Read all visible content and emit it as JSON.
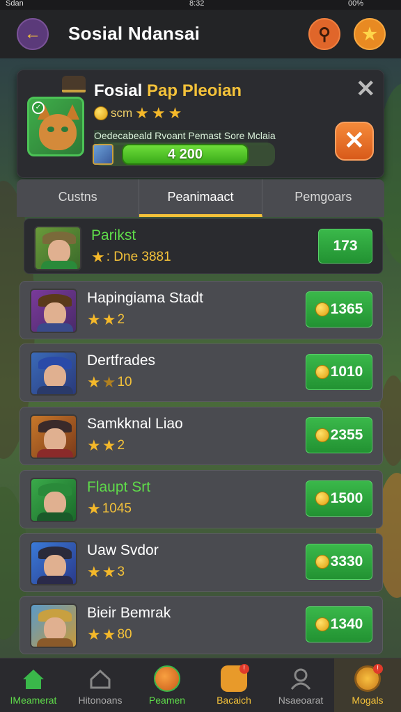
{
  "status_bar": {
    "carrier": "Sdan",
    "time": "8:32",
    "battery": "00%"
  },
  "header": {
    "title": "Sosial Ndansai"
  },
  "profile": {
    "name_part1": "Fosial",
    "name_part2": "Pap Pleoian",
    "coins_text": "scm",
    "stars": 3,
    "subtitle": "Oedecabeald Rvoant Pemast Sore Mclaia",
    "progress_value": "4 200"
  },
  "tabs": [
    {
      "label": "Custns"
    },
    {
      "label": "Peanimaact",
      "active": true
    },
    {
      "label": "Pemgoars"
    }
  ],
  "rows": [
    {
      "name": "Parikst",
      "meta": ": Dne 3881",
      "stars": 1,
      "value": "173",
      "coin": false,
      "highlight": true
    },
    {
      "name": "Hapingiama Stadt",
      "meta": "2",
      "stars": 2,
      "value": "1365",
      "coin": true
    },
    {
      "name": "Dertfrades",
      "meta": "10",
      "stars": 2,
      "value": "1010",
      "coin": true
    },
    {
      "name": "Samkknal Liao",
      "meta": "2",
      "stars": 2,
      "value": "2355",
      "coin": true
    },
    {
      "name": "Flaupt Srt",
      "meta": "1045",
      "stars": 1,
      "value": "1500",
      "coin": true
    },
    {
      "name": "Uaw Svdor",
      "meta": "3",
      "stars": 2,
      "value": "3330",
      "coin": true
    },
    {
      "name": "Bieir Bemrak",
      "meta": "80",
      "stars": 2,
      "value": "1340",
      "coin": true
    }
  ],
  "nav": [
    {
      "label": "IMeamerat",
      "icon": "home-icon"
    },
    {
      "label": "Hitonoans",
      "icon": "house-outline-icon"
    },
    {
      "label": "Peamen",
      "icon": "ball-icon"
    },
    {
      "label": "Bacaich",
      "icon": "bag-icon",
      "badge": "!"
    },
    {
      "label": "Nsaeoarat",
      "icon": "person-icon"
    },
    {
      "label": "Mogals",
      "icon": "medal-icon",
      "badge": "!"
    }
  ],
  "colors": {
    "accent": "#f4c23a",
    "green": "#3ab84a",
    "orange": "#e0662a"
  }
}
